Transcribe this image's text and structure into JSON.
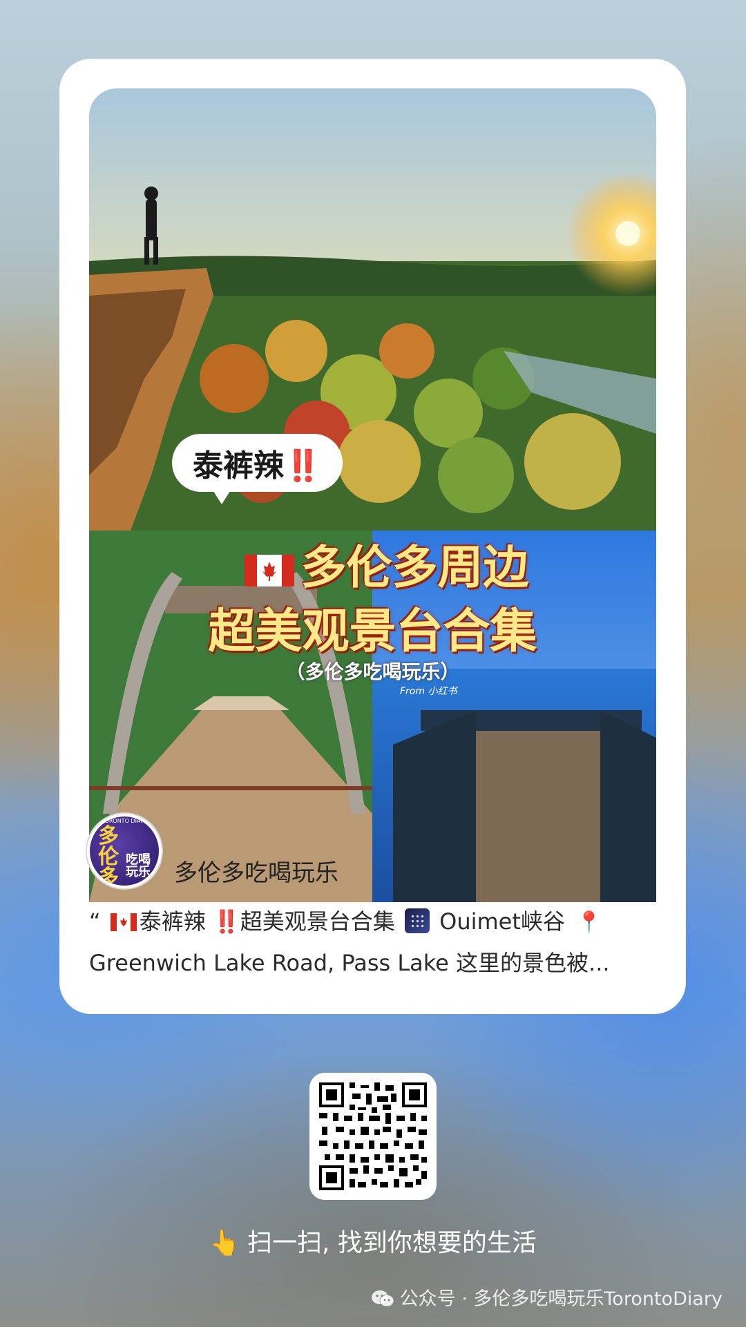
{
  "cover": {
    "tag_label": "泰裤辣",
    "tag_excl": "‼️",
    "headline_line1": "多伦多周边",
    "headline_line2": "超美观景台合集",
    "subbrand": "（多伦多吃喝玩乐）",
    "from_label": "From 小红书"
  },
  "avatar": {
    "big_text": "多伦多",
    "small_text": "吃喝玩乐",
    "ring_text": "TORONTO DIARY"
  },
  "account": {
    "name": "多伦多吃喝玩乐"
  },
  "excerpt": {
    "quote": "“",
    "part1": "泰裤辣",
    "excl": "‼️",
    "part2": "超美观景台合集",
    "part3": "Ouimet峡谷",
    "pin": "📍",
    "line2": "Greenwich Lake Road, Pass Lake 这里的景色被..."
  },
  "scan": {
    "hand": "👆",
    "text": "扫一扫, 找到你想要的生活"
  },
  "footer": {
    "text": "公众号 · 多伦多吃喝玩乐TorontoDiary"
  }
}
